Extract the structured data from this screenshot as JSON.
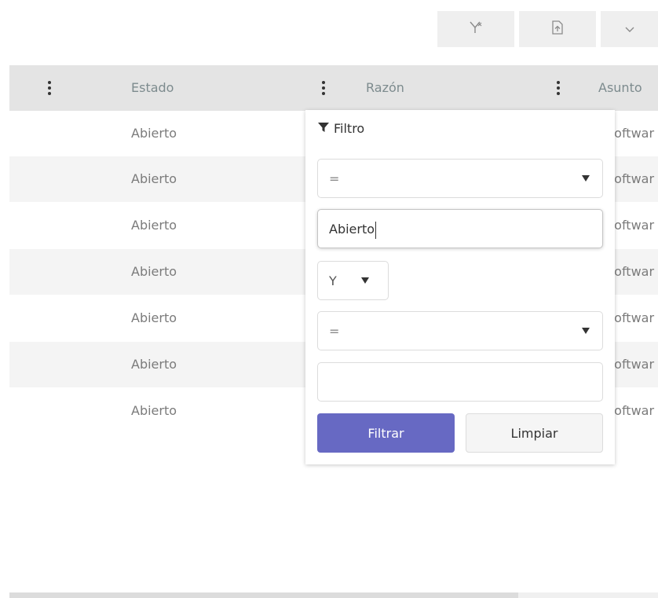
{
  "toolbar": {
    "icons": [
      "filter-clear-icon",
      "file-export-icon",
      "chevron-down-icon"
    ]
  },
  "table": {
    "columns": [
      "Estado",
      "Razón",
      "Asunto"
    ],
    "rows": [
      {
        "estado": "Abierto",
        "asunto": "Softwar"
      },
      {
        "estado": "Abierto",
        "asunto": "Softwar"
      },
      {
        "estado": "Abierto",
        "asunto": "Softwar"
      },
      {
        "estado": "Abierto",
        "asunto": "Softwar"
      },
      {
        "estado": "Abierto",
        "asunto": "Softwar"
      },
      {
        "estado": "Abierto",
        "asunto": "Softwar"
      },
      {
        "estado": "Abierto",
        "asunto": "Softwar"
      }
    ]
  },
  "filter": {
    "title": "Filtro",
    "operator1": "=",
    "value1": "Abierto",
    "logic": "Y",
    "operator2": "=",
    "value2": "",
    "apply_label": "Filtrar",
    "clear_label": "Limpiar"
  },
  "colors": {
    "primary": "#6769c3",
    "header_bg": "#e4e4e4",
    "alt_row": "#f4f4f4"
  }
}
